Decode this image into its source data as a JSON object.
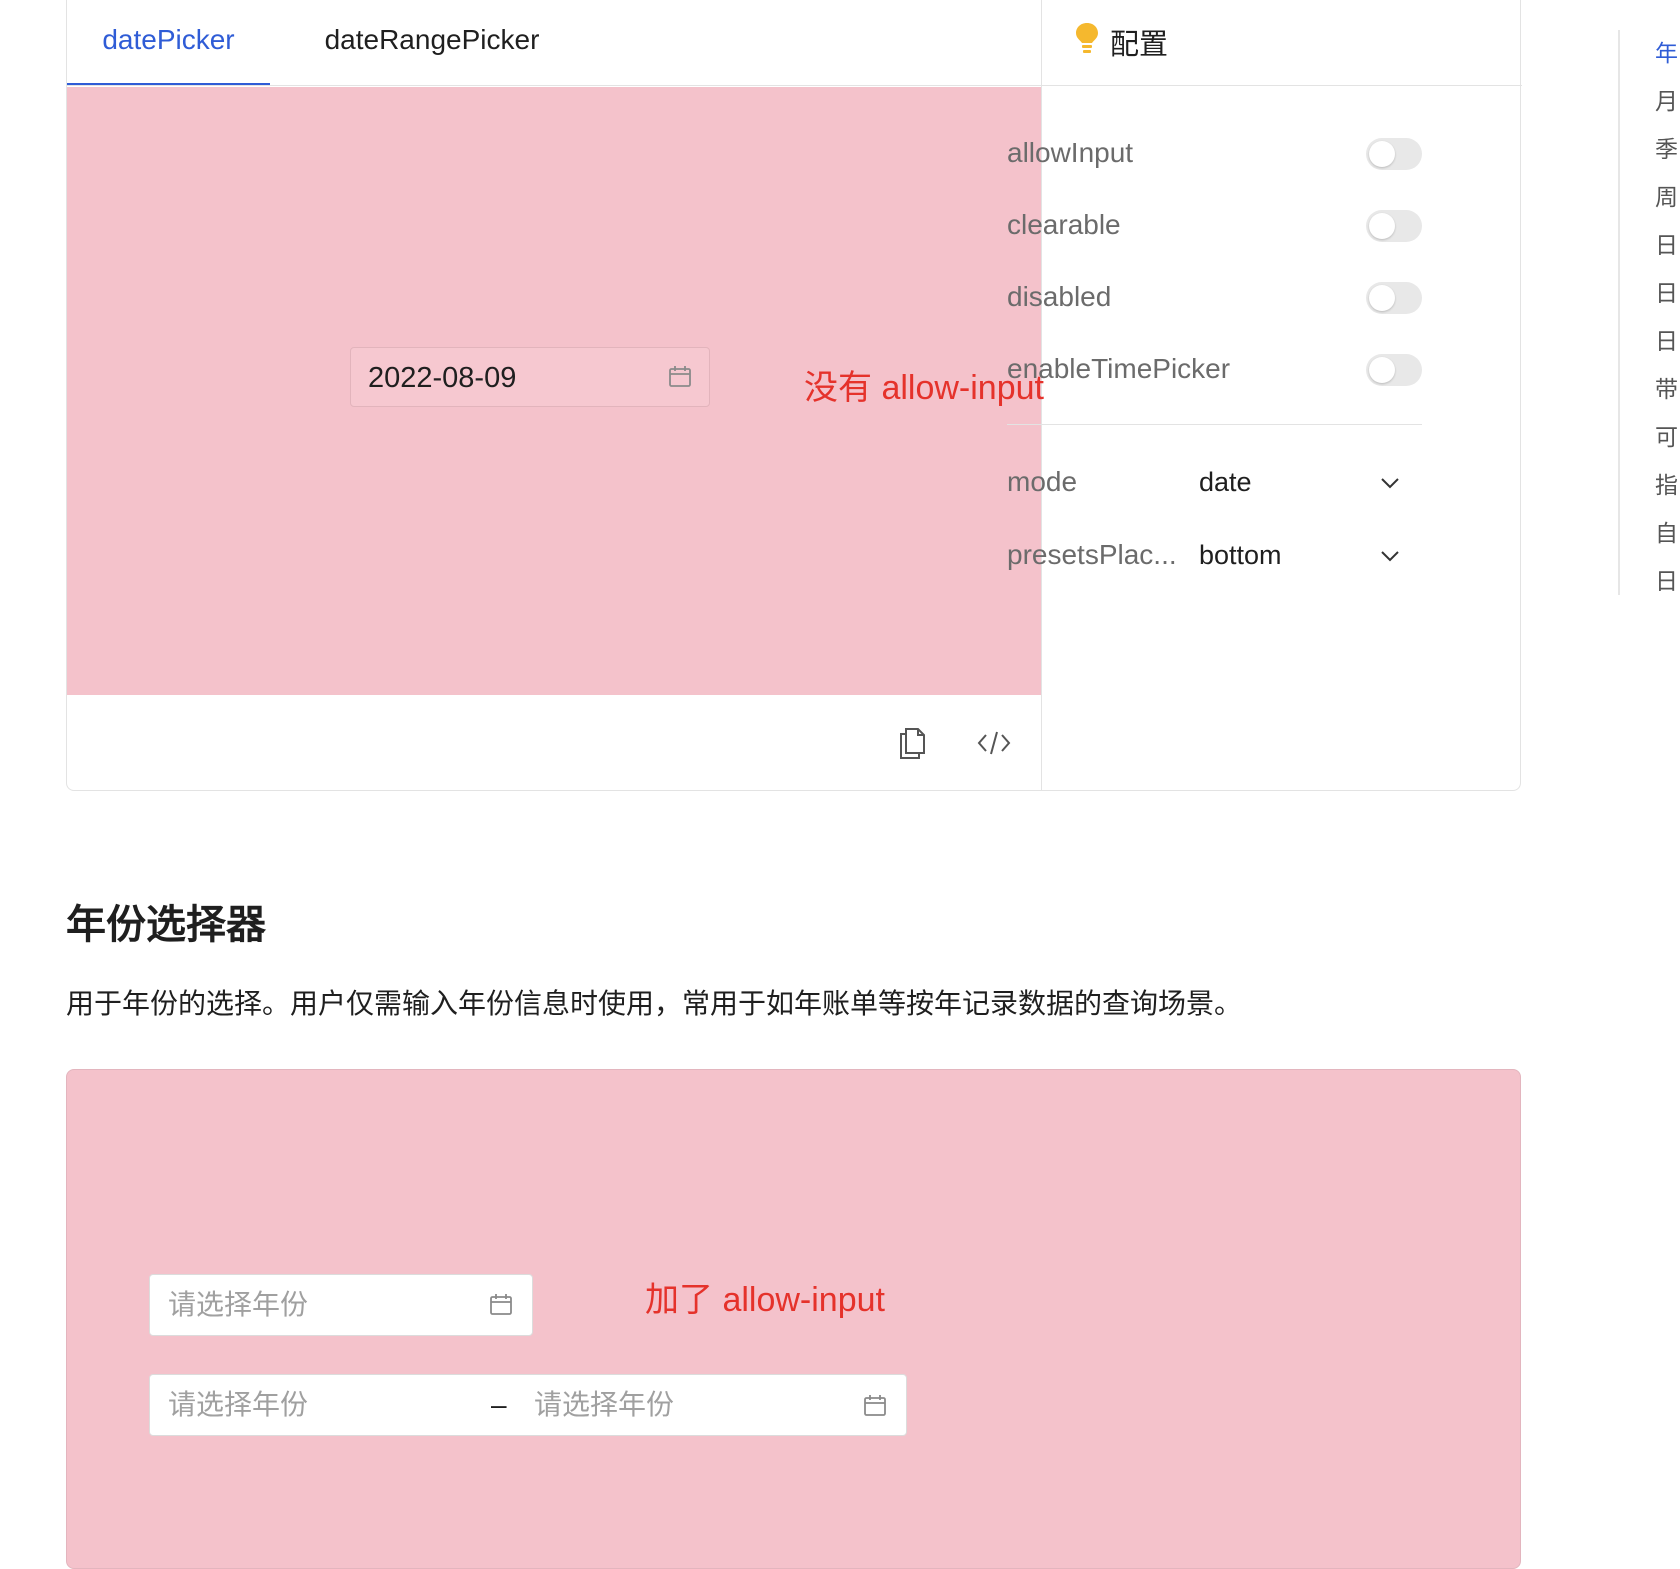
{
  "tabs": [
    {
      "label": "datePicker",
      "active": true
    },
    {
      "label": "dateRangePicker",
      "active": false
    }
  ],
  "preview": {
    "date_value": "2022-08-09",
    "annotation": "没有 allow-input"
  },
  "config": {
    "title": "配置",
    "toggles": [
      {
        "label": "allowInput",
        "on": false
      },
      {
        "label": "clearable",
        "on": false
      },
      {
        "label": "disabled",
        "on": false
      },
      {
        "label": "enableTimePicker",
        "on": false
      }
    ],
    "selects": [
      {
        "label": "mode",
        "value": "date"
      },
      {
        "label": "presetsPlac...",
        "value": "bottom"
      }
    ]
  },
  "anchor_nav": {
    "items": [
      "年",
      "月",
      "季",
      "周",
      "日",
      "日",
      "日",
      "带",
      "可",
      "指",
      "自",
      "日"
    ],
    "active_index": 0
  },
  "section": {
    "title": "年份选择器",
    "description": "用于年份的选择。用户仅需输入年份信息时使用，常用于如年账单等按年记录数据的查询场景。"
  },
  "demo2": {
    "annotation": "加了 allow-input",
    "year_placeholder": "请选择年份",
    "range_start_placeholder": "请选择年份",
    "range_separator": "–",
    "range_end_placeholder": "请选择年份"
  },
  "colors": {
    "accent": "#2f5cd6",
    "preview_bg": "#f4c2cb",
    "annotation": "#e5322b",
    "bulb": "#f5b82e"
  },
  "icons": {
    "calendar": "calendar-icon",
    "copy": "copy-icon",
    "code": "code-icon",
    "bulb": "lightbulb-icon",
    "chevron": "chevron-down-icon"
  }
}
